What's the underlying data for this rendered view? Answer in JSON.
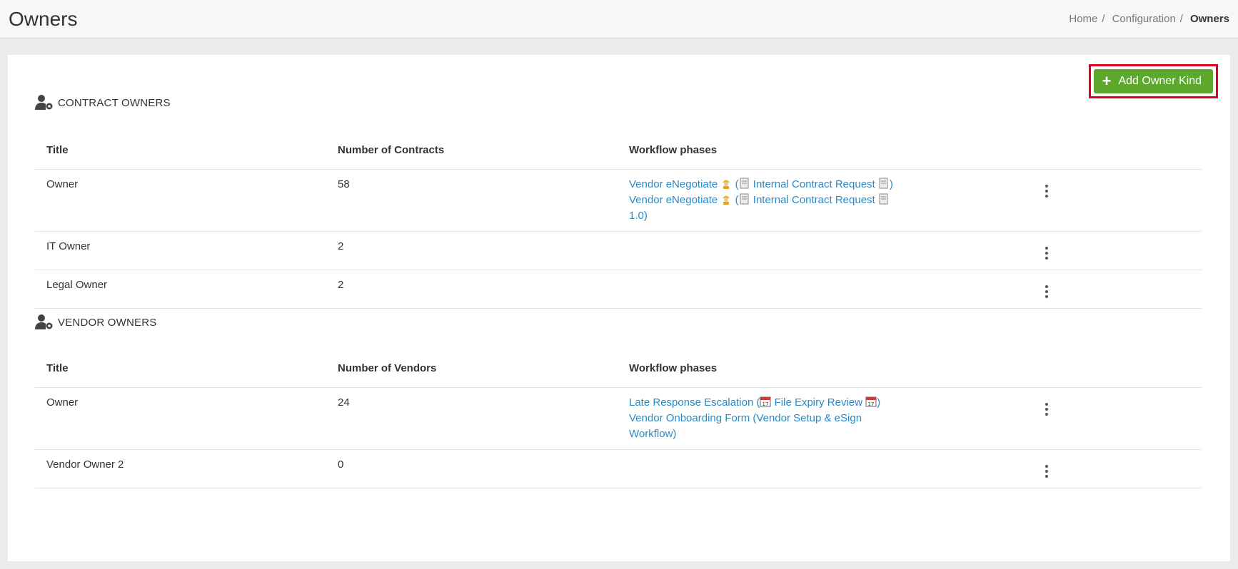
{
  "page": {
    "title": "Owners",
    "breadcrumb": [
      "Home",
      "Configuration",
      "Owners"
    ],
    "breadcrumb_sep": "/"
  },
  "toolbar": {
    "add_label": "Add Owner Kind",
    "accent": "#5ca82c",
    "highlight": "#e0001b"
  },
  "contract_owners": {
    "heading": "CONTRACT OWNERS",
    "columns": [
      "Title",
      "Number of Contracts",
      "Workflow phases"
    ],
    "rows": [
      {
        "title": "Owner",
        "count": "58",
        "workflow": [
          [
            "Vendor eNegotiate",
            "worker-icon",
            " (",
            "document-icon",
            "Internal Contract Request",
            "document-icon",
            ")"
          ],
          [
            "Vendor eNegotiate",
            "worker-icon",
            " (",
            "document-icon",
            "Internal Contract Request",
            "document-icon",
            " 1.0)"
          ]
        ]
      },
      {
        "title": "IT Owner",
        "count": "2",
        "workflow": []
      },
      {
        "title": "Legal Owner",
        "count": "2",
        "workflow": []
      }
    ]
  },
  "vendor_owners": {
    "heading": "VENDOR OWNERS",
    "columns": [
      "Title",
      "Number of Vendors",
      "Workflow phases"
    ],
    "rows": [
      {
        "title": "Owner",
        "count": "24",
        "workflow_text_1a": "Late Response Escalation",
        "workflow_text_1b": "File Expiry Review",
        "workflow_text_2": "Vendor Onboarding Form (Vendor Setup & eSign Workflow)"
      },
      {
        "title": "Vendor Owner 2",
        "count": "0"
      }
    ]
  }
}
